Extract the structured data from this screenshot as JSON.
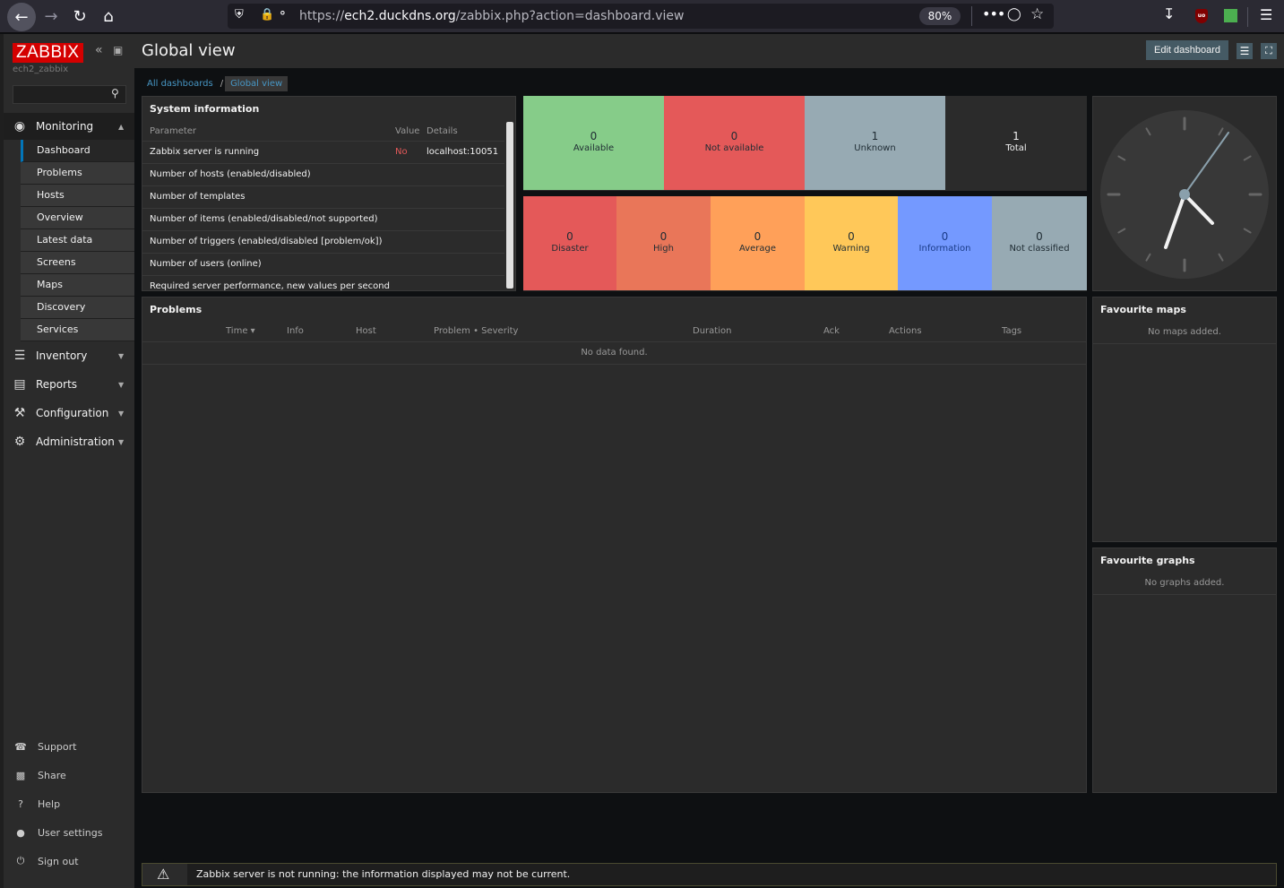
{
  "browser": {
    "url_prefix": "https://",
    "url_host": "ech2.duckdns.org",
    "url_path": "/zabbix.php?action=dashboard.view",
    "zoom": "80%"
  },
  "sidebar": {
    "logo": "ZABBIX",
    "server_name": "ech2_zabbix",
    "search_placeholder": "",
    "monitoring": {
      "label": "Monitoring",
      "items": [
        "Dashboard",
        "Problems",
        "Hosts",
        "Overview",
        "Latest data",
        "Screens",
        "Maps",
        "Discovery",
        "Services"
      ]
    },
    "sections": [
      "Inventory",
      "Reports",
      "Configuration",
      "Administration"
    ],
    "bottom_links": [
      "Support",
      "Share",
      "Help",
      "User settings",
      "Sign out"
    ]
  },
  "header": {
    "title": "Global view",
    "edit_button": "Edit dashboard"
  },
  "breadcrumb": {
    "all": "All dashboards",
    "sep": "/",
    "current": "Global view"
  },
  "system_info": {
    "title": "System information",
    "columns": [
      "Parameter",
      "Value",
      "Details"
    ],
    "rows": [
      {
        "param": "Zabbix server is running",
        "value": "No",
        "details": "localhost:10051"
      },
      {
        "param": "Number of hosts (enabled/disabled)",
        "value": "",
        "details": ""
      },
      {
        "param": "Number of templates",
        "value": "",
        "details": ""
      },
      {
        "param": "Number of items (enabled/disabled/not supported)",
        "value": "",
        "details": ""
      },
      {
        "param": "Number of triggers (enabled/disabled [problem/ok])",
        "value": "",
        "details": ""
      },
      {
        "param": "Number of users (online)",
        "value": "",
        "details": ""
      },
      {
        "param": "Required server performance, new values per second",
        "value": "",
        "details": ""
      }
    ]
  },
  "availability": [
    {
      "count": "0",
      "label": "Available",
      "color": "#86cc89"
    },
    {
      "count": "0",
      "label": "Not available",
      "color": "#e45959"
    },
    {
      "count": "1",
      "label": "Unknown",
      "color": "#97aab3"
    },
    {
      "count": "1",
      "label": "Total",
      "color": "#2b2b2b"
    }
  ],
  "severity": [
    {
      "count": "0",
      "label": "Disaster",
      "color": "#e45959"
    },
    {
      "count": "0",
      "label": "High",
      "color": "#e97659"
    },
    {
      "count": "0",
      "label": "Average",
      "color": "#ffa059"
    },
    {
      "count": "0",
      "label": "Warning",
      "color": "#ffc859"
    },
    {
      "count": "0",
      "label": "Information",
      "color": "#7499ff"
    },
    {
      "count": "0",
      "label": "Not classified",
      "color": "#97aab3"
    }
  ],
  "problems": {
    "title": "Problems",
    "columns": [
      "Time ▾",
      "Info",
      "Host",
      "Problem • Severity",
      "Duration",
      "Ack",
      "Actions",
      "Tags"
    ],
    "empty": "No data found."
  },
  "fav_maps": {
    "title": "Favourite maps",
    "empty": "No maps added."
  },
  "fav_graphs": {
    "title": "Favourite graphs",
    "empty": "No graphs added."
  },
  "warning": {
    "text": "Zabbix server is not running: the information displayed may not be current."
  },
  "colors": {
    "accent": "#0275b8",
    "link": "#4796c4",
    "logo": "#d40000"
  },
  "icons": {
    "monitoring": "eye-icon",
    "inventory": "list-icon",
    "reports": "bar-chart-icon",
    "configuration": "wrench-icon",
    "administration": "gear-icon"
  }
}
